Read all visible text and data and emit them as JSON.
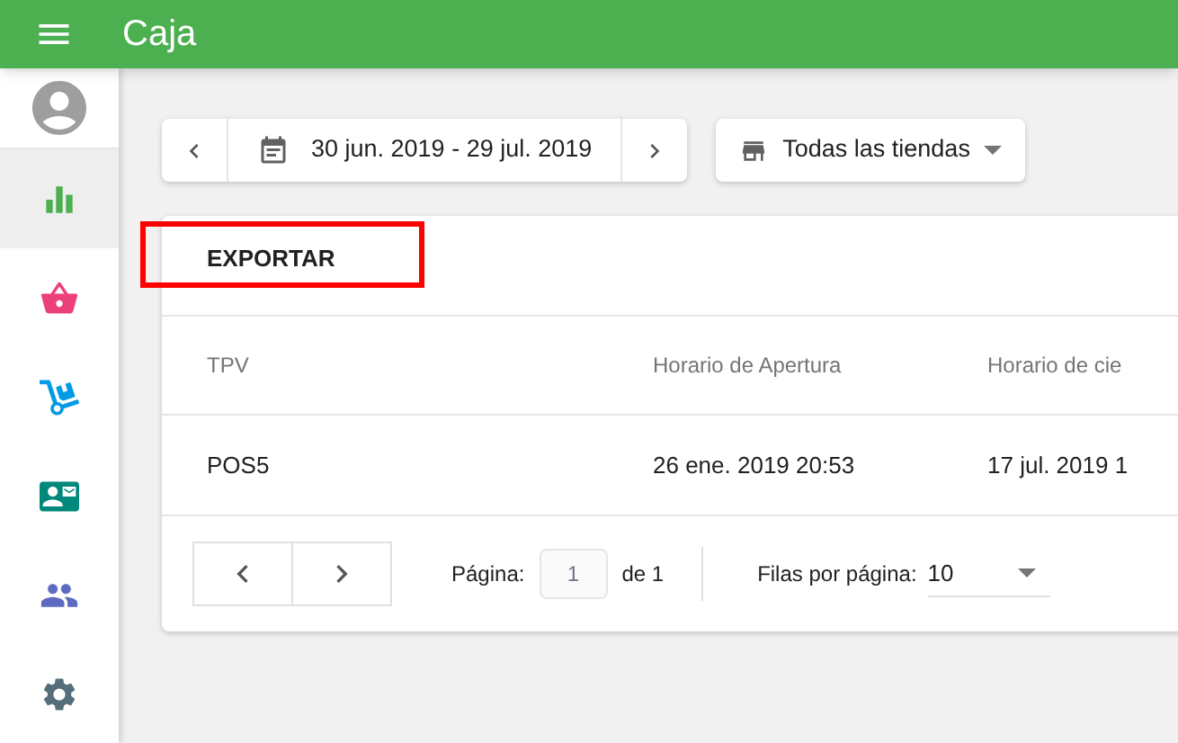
{
  "app_bar": {
    "title": "Caja"
  },
  "sidebar": {
    "items": [
      {
        "kind": "chart",
        "selected": true,
        "color": "#4caf50"
      },
      {
        "kind": "basket",
        "selected": false,
        "color": "#ec407a"
      },
      {
        "kind": "dolly",
        "selected": false,
        "color": "#039be5"
      },
      {
        "kind": "card",
        "selected": false,
        "color": "#00897b"
      },
      {
        "kind": "people",
        "selected": false,
        "color": "#5c6bc0"
      },
      {
        "kind": "gear",
        "selected": false,
        "color": "#546e7a"
      }
    ]
  },
  "date_range": {
    "label": "30 jun. 2019 - 29 jul. 2019"
  },
  "store_select": {
    "value": "Todas las tiendas"
  },
  "export_button": {
    "label": "EXPORTAR",
    "highlighted": true
  },
  "table": {
    "columns": [
      "TPV",
      "Horario de Apertura",
      "Horario de cie"
    ],
    "rows": [
      [
        "POS5",
        "26 ene. 2019 20:53",
        "17 jul. 2019 1"
      ]
    ]
  },
  "pagination": {
    "page_label": "Página:",
    "page": "1",
    "of_label": "de 1",
    "rows_label": "Filas por página:",
    "rows_value": "10"
  }
}
